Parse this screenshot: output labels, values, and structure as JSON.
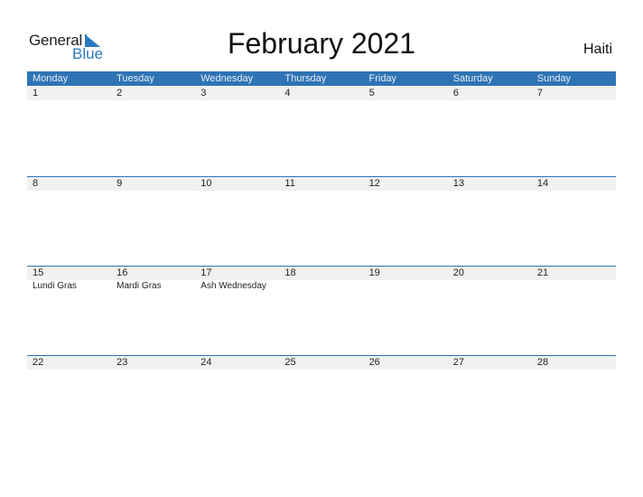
{
  "logo": {
    "text_general": "General",
    "text_blue": "Blue"
  },
  "title": "February 2021",
  "country": "Haiti",
  "colors": {
    "accent": "#2e74b5",
    "band": "#f1f1f1",
    "logo_blue": "#2a7ac0"
  },
  "weekdays": [
    "Monday",
    "Tuesday",
    "Wednesday",
    "Thursday",
    "Friday",
    "Saturday",
    "Sunday"
  ],
  "weeks": [
    {
      "days": [
        {
          "day": "1",
          "holiday": ""
        },
        {
          "day": "2",
          "holiday": ""
        },
        {
          "day": "3",
          "holiday": ""
        },
        {
          "day": "4",
          "holiday": ""
        },
        {
          "day": "5",
          "holiday": ""
        },
        {
          "day": "6",
          "holiday": ""
        },
        {
          "day": "7",
          "holiday": ""
        }
      ]
    },
    {
      "days": [
        {
          "day": "8",
          "holiday": ""
        },
        {
          "day": "9",
          "holiday": ""
        },
        {
          "day": "10",
          "holiday": ""
        },
        {
          "day": "11",
          "holiday": ""
        },
        {
          "day": "12",
          "holiday": ""
        },
        {
          "day": "13",
          "holiday": ""
        },
        {
          "day": "14",
          "holiday": ""
        }
      ]
    },
    {
      "days": [
        {
          "day": "15",
          "holiday": "Lundi Gras"
        },
        {
          "day": "16",
          "holiday": "Mardi Gras"
        },
        {
          "day": "17",
          "holiday": "Ash Wednesday"
        },
        {
          "day": "18",
          "holiday": ""
        },
        {
          "day": "19",
          "holiday": ""
        },
        {
          "day": "20",
          "holiday": ""
        },
        {
          "day": "21",
          "holiday": ""
        }
      ]
    },
    {
      "days": [
        {
          "day": "22",
          "holiday": ""
        },
        {
          "day": "23",
          "holiday": ""
        },
        {
          "day": "24",
          "holiday": ""
        },
        {
          "day": "25",
          "holiday": ""
        },
        {
          "day": "26",
          "holiday": ""
        },
        {
          "day": "27",
          "holiday": ""
        },
        {
          "day": "28",
          "holiday": ""
        }
      ]
    }
  ]
}
